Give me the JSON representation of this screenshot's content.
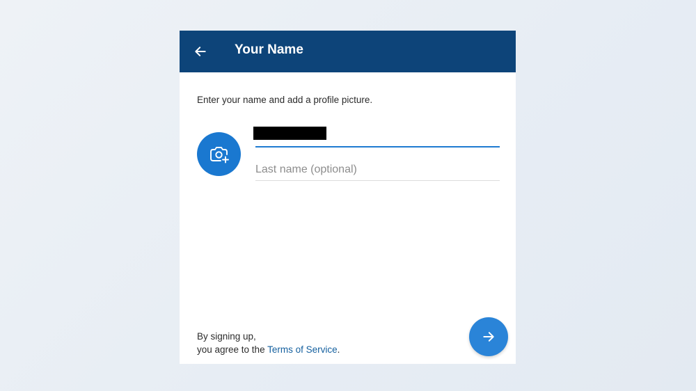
{
  "header": {
    "title": "Your Name",
    "background_color": "#0d4479",
    "back_icon": "arrow-left-icon"
  },
  "form": {
    "instruction": "Enter your name and add a profile picture.",
    "avatar_icon": "camera-add-icon",
    "avatar_color": "#1a78d0",
    "first_name_value": "",
    "last_name_placeholder": "Last name (optional)",
    "accent_color": "#1e7bd1"
  },
  "footer": {
    "terms_line1": "By signing up,",
    "terms_line2_prefix": "you agree to the ",
    "terms_link": "Terms of Service",
    "terms_suffix": ".",
    "next_icon": "arrow-right-icon"
  }
}
